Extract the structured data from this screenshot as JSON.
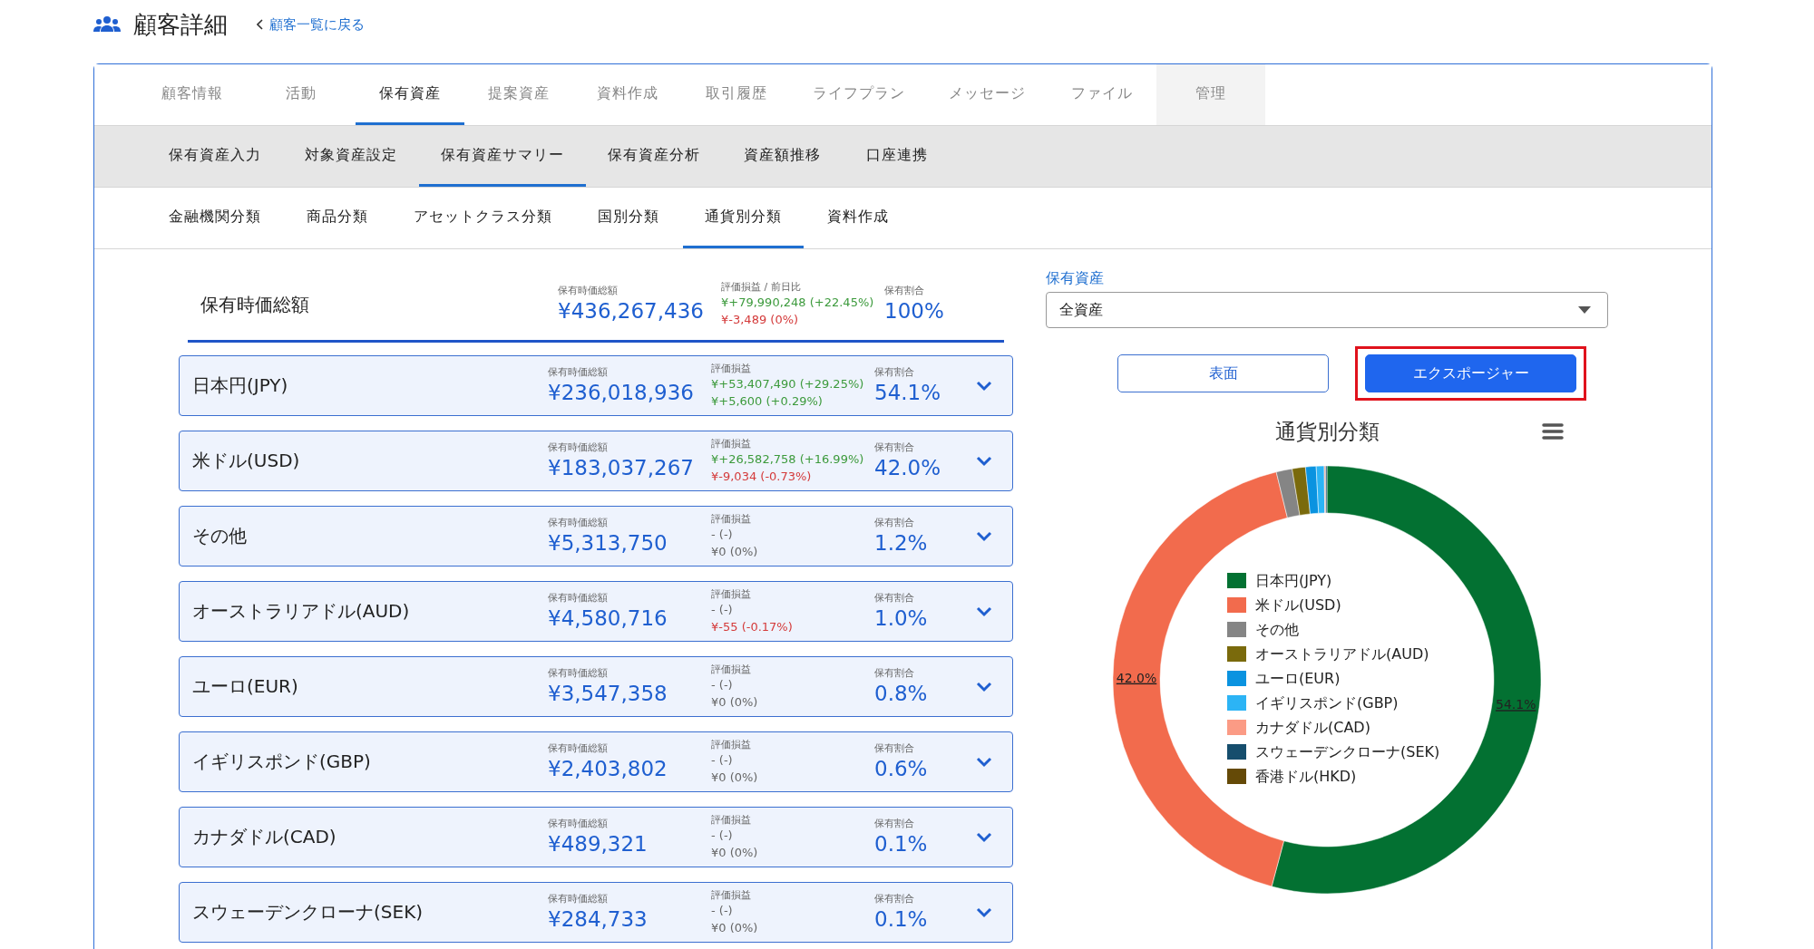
{
  "header": {
    "title": "顧客詳細",
    "back_link": "顧客一覧に戻る"
  },
  "main_tabs": [
    {
      "label": "顧客情報",
      "selected": false,
      "hovered": false
    },
    {
      "label": "活動",
      "selected": false,
      "hovered": false
    },
    {
      "label": "保有資産",
      "selected": true,
      "hovered": false
    },
    {
      "label": "提案資産",
      "selected": false,
      "hovered": false
    },
    {
      "label": "資料作成",
      "selected": false,
      "hovered": false
    },
    {
      "label": "取引履歴",
      "selected": false,
      "hovered": false
    },
    {
      "label": "ライフプラン",
      "selected": false,
      "hovered": false
    },
    {
      "label": "メッセージ",
      "selected": false,
      "hovered": false
    },
    {
      "label": "ファイル",
      "selected": false,
      "hovered": false
    },
    {
      "label": "管理",
      "selected": false,
      "hovered": true
    }
  ],
  "sub_tabs": [
    {
      "label": "保有資産入力",
      "selected": false
    },
    {
      "label": "対象資産設定",
      "selected": false
    },
    {
      "label": "保有資産サマリー",
      "selected": true
    },
    {
      "label": "保有資産分析",
      "selected": false
    },
    {
      "label": "資産額推移",
      "selected": false
    },
    {
      "label": "口座連携",
      "selected": false
    }
  ],
  "category_tabs": [
    {
      "label": "金融機関分類",
      "selected": false
    },
    {
      "label": "商品分類",
      "selected": false
    },
    {
      "label": "アセットクラス分類",
      "selected": false
    },
    {
      "label": "国別分類",
      "selected": false
    },
    {
      "label": "通貨別分類",
      "selected": true
    },
    {
      "label": "資料作成",
      "selected": false
    }
  ],
  "summary": {
    "name": "保有時価総額",
    "amount_label": "保有時価総額",
    "amount": "¥436,267,436",
    "pl_label": "評価損益 / 前日比",
    "pl": [
      {
        "text": "¥+79,990,248 (+22.45%)",
        "color": "#3c9a3c"
      },
      {
        "text": "¥-3,489 (0%)",
        "color": "#d43a3a"
      }
    ],
    "share_label": "保有割合",
    "share": "100%"
  },
  "rows": [
    {
      "name": "日本円(JPY)",
      "amount_label": "保有時価総額",
      "amount": "¥236,018,936",
      "pl_label": "評価損益",
      "pl": [
        {
          "text": "¥+53,407,490 (+29.25%)",
          "color": "#3c9a3c"
        },
        {
          "text": "¥+5,600 (+0.29%)",
          "color": "#3c9a3c"
        }
      ],
      "share_label": "保有割合",
      "share": "54.1%",
      "expanded": false
    },
    {
      "name": "米ドル(USD)",
      "amount_label": "保有時価総額",
      "amount": "¥183,037,267",
      "pl_label": "評価損益",
      "pl": [
        {
          "text": "¥+26,582,758 (+16.99%)",
          "color": "#3c9a3c"
        },
        {
          "text": "¥-9,034 (-0.73%)",
          "color": "#d43a3a"
        }
      ],
      "share_label": "保有割合",
      "share": "42.0%",
      "expanded": false
    },
    {
      "name": "その他",
      "amount_label": "保有時価総額",
      "amount": "¥5,313,750",
      "pl_label": "評価損益",
      "pl": [
        {
          "text": "- (-)",
          "color": "#666666"
        },
        {
          "text": "¥0 (0%)",
          "color": "#666666"
        }
      ],
      "share_label": "保有割合",
      "share": "1.2%",
      "expanded": false
    },
    {
      "name": "オーストラリアドル(AUD)",
      "amount_label": "保有時価総額",
      "amount": "¥4,580,716",
      "pl_label": "評価損益",
      "pl": [
        {
          "text": "- (-)",
          "color": "#666666"
        },
        {
          "text": "¥-55 (-0.17%)",
          "color": "#d43a3a"
        }
      ],
      "share_label": "保有割合",
      "share": "1.0%",
      "expanded": false
    },
    {
      "name": "ユーロ(EUR)",
      "amount_label": "保有時価総額",
      "amount": "¥3,547,358",
      "pl_label": "評価損益",
      "pl": [
        {
          "text": "- (-)",
          "color": "#666666"
        },
        {
          "text": "¥0 (0%)",
          "color": "#666666"
        }
      ],
      "share_label": "保有割合",
      "share": "0.8%",
      "expanded": false
    },
    {
      "name": "イギリスポンド(GBP)",
      "amount_label": "保有時価総額",
      "amount": "¥2,403,802",
      "pl_label": "評価損益",
      "pl": [
        {
          "text": "- (-)",
          "color": "#666666"
        },
        {
          "text": "¥0 (0%)",
          "color": "#666666"
        }
      ],
      "share_label": "保有割合",
      "share": "0.6%",
      "expanded": false
    },
    {
      "name": "カナダドル(CAD)",
      "amount_label": "保有時価総額",
      "amount": "¥489,321",
      "pl_label": "評価損益",
      "pl": [
        {
          "text": "- (-)",
          "color": "#666666"
        },
        {
          "text": "¥0 (0%)",
          "color": "#666666"
        }
      ],
      "share_label": "保有割合",
      "share": "0.1%",
      "expanded": false
    },
    {
      "name": "スウェーデンクローナ(SEK)",
      "amount_label": "保有時価総額",
      "amount": "¥284,733",
      "pl_label": "評価損益",
      "pl": [
        {
          "text": "- (-)",
          "color": "#666666"
        },
        {
          "text": "¥0 (0%)",
          "color": "#666666"
        }
      ],
      "share_label": "保有割合",
      "share": "0.1%",
      "expanded": false
    }
  ],
  "asset_filter": {
    "label": "保有資産",
    "value": "全資産"
  },
  "view_buttons": [
    {
      "label": "表面",
      "selected": false,
      "highlighted": false
    },
    {
      "label": "エクスポージャー",
      "selected": true,
      "highlighted": true
    }
  ],
  "chart": {
    "chart_data": {
      "type": "donut",
      "title": "通貨別分類",
      "categories": [
        "日本円(JPY)",
        "米ドル(USD)",
        "その他",
        "オーストラリアドル(AUD)",
        "ユーロ(EUR)",
        "イギリスポンド(GBP)",
        "カナダドル(CAD)",
        "スウェーデンクローナ(SEK)",
        "香港ドル(HKD)"
      ],
      "series": [
        {
          "colors": [
            "#037132",
            "#f26b4d",
            "#858585",
            "#7a6a0c",
            "#0a93e0",
            "#2cb4f5",
            "#fb9b85",
            "#164e6d",
            "#654a07"
          ],
          "values": [
            54.1,
            42.0,
            1.2,
            1.0,
            0.8,
            0.6,
            0.1,
            0.1,
            null
          ]
        }
      ],
      "value_labels": [
        "54.1%",
        "42.0%"
      ],
      "legend": "center"
    }
  }
}
